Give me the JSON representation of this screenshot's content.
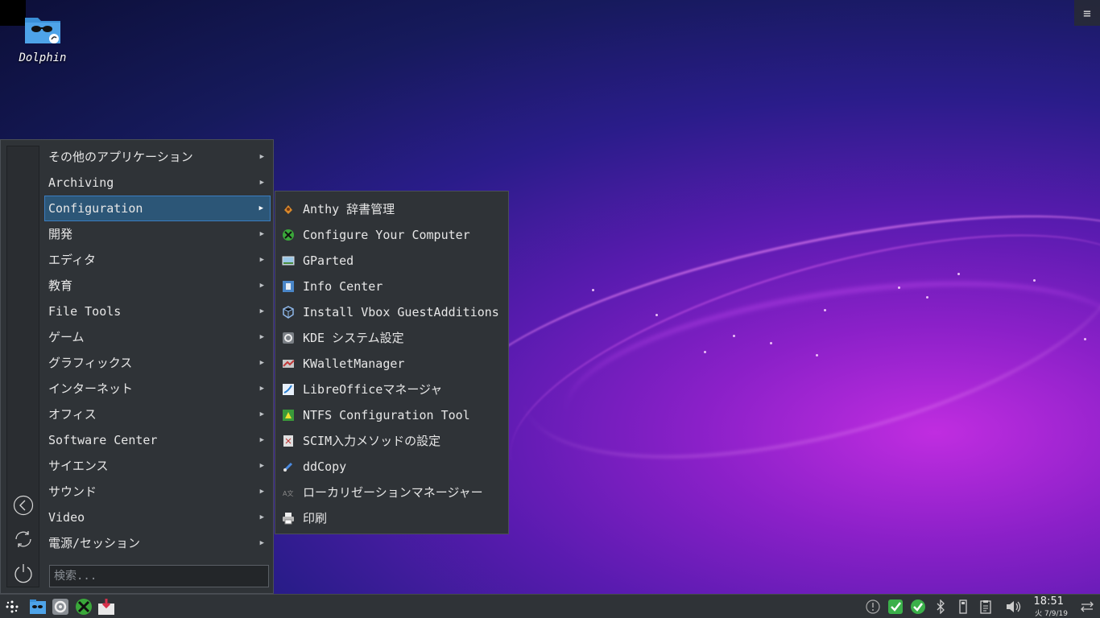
{
  "desktop": {
    "icon_label": "Dolphin"
  },
  "menu": {
    "categories": [
      {
        "label": "その他のアプリケーション"
      },
      {
        "label": "Archiving"
      },
      {
        "label": "Configuration"
      },
      {
        "label": "開発"
      },
      {
        "label": "エディタ"
      },
      {
        "label": "教育"
      },
      {
        "label": "File Tools"
      },
      {
        "label": "ゲーム"
      },
      {
        "label": "グラフィックス"
      },
      {
        "label": "インターネット"
      },
      {
        "label": "オフィス"
      },
      {
        "label": "Software Center"
      },
      {
        "label": "サイエンス"
      },
      {
        "label": "サウンド"
      },
      {
        "label": "Video"
      },
      {
        "label": "電源/セッション"
      }
    ],
    "selected_category": "Configuration",
    "search_placeholder": "検索..."
  },
  "submenu": {
    "items": [
      {
        "label": "Anthy 辞書管理",
        "icon": "anthy-icon"
      },
      {
        "label": "Configure Your Computer",
        "icon": "configure-icon"
      },
      {
        "label": "GParted",
        "icon": "gparted-icon"
      },
      {
        "label": "Info Center",
        "icon": "info-center-icon"
      },
      {
        "label": "Install Vbox GuestAdditions",
        "icon": "vbox-icon"
      },
      {
        "label": "KDE システム設定",
        "icon": "kde-settings-icon"
      },
      {
        "label": "KWalletManager",
        "icon": "kwallet-icon"
      },
      {
        "label": "LibreOfficeマネージャ",
        "icon": "libreoffice-icon"
      },
      {
        "label": "NTFS Configuration Tool",
        "icon": "ntfs-icon"
      },
      {
        "label": "SCIM入力メソッドの設定",
        "icon": "scim-icon"
      },
      {
        "label": "ddCopy",
        "icon": "ddcopy-icon"
      },
      {
        "label": "ローカリゼーションマネージャー",
        "icon": "localization-icon"
      },
      {
        "label": "印刷",
        "icon": "printer-icon"
      }
    ]
  },
  "taskbar": {
    "clock_time": "18:51",
    "clock_date": "火 7/9/19"
  },
  "colors": {
    "menu_bg": "#2f3337",
    "selection": "#2c5677",
    "selection_border": "#3b7dbf"
  }
}
